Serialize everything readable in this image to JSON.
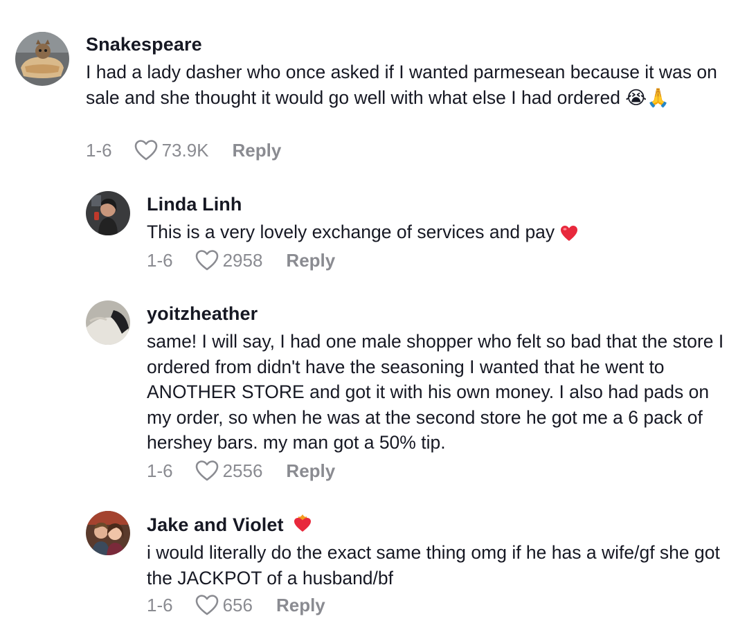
{
  "comments": [
    {
      "username": "Snakespeare",
      "text": "I had a lady dasher who once asked if I wanted parmesean because it was on sale and she thought it would go well with what else I had ordered 😭🙏",
      "date": "1-6",
      "likes": "73.9K",
      "reply_label": "Reply"
    },
    {
      "username": "Linda Linh",
      "text": "This is a very lovely exchange of services and pay",
      "date": "1-6",
      "likes": "2958",
      "reply_label": "Reply"
    },
    {
      "username": "yoitzheather",
      "text": "same! I will say, I had one male shopper who felt so bad that the store I ordered from didn't have the seasoning I wanted that he went to ANOTHER STORE and got it with his own money. I also had pads on my order, so when he was at the second store he got me a 6 pack of hershey bars. my man got a 50% tip.",
      "date": "1-6",
      "likes": "2556",
      "reply_label": "Reply"
    },
    {
      "username": "Jake and Violet",
      "text": "i would literally do the exact same thing omg if he has a wife/gf she got the JACKPOT of a husband/bf",
      "date": "1-6",
      "likes": "656",
      "reply_label": "Reply"
    }
  ],
  "colors": {
    "text": "#161823",
    "secondary": "#8a8b91",
    "heart_emoji": "#e8283c"
  }
}
